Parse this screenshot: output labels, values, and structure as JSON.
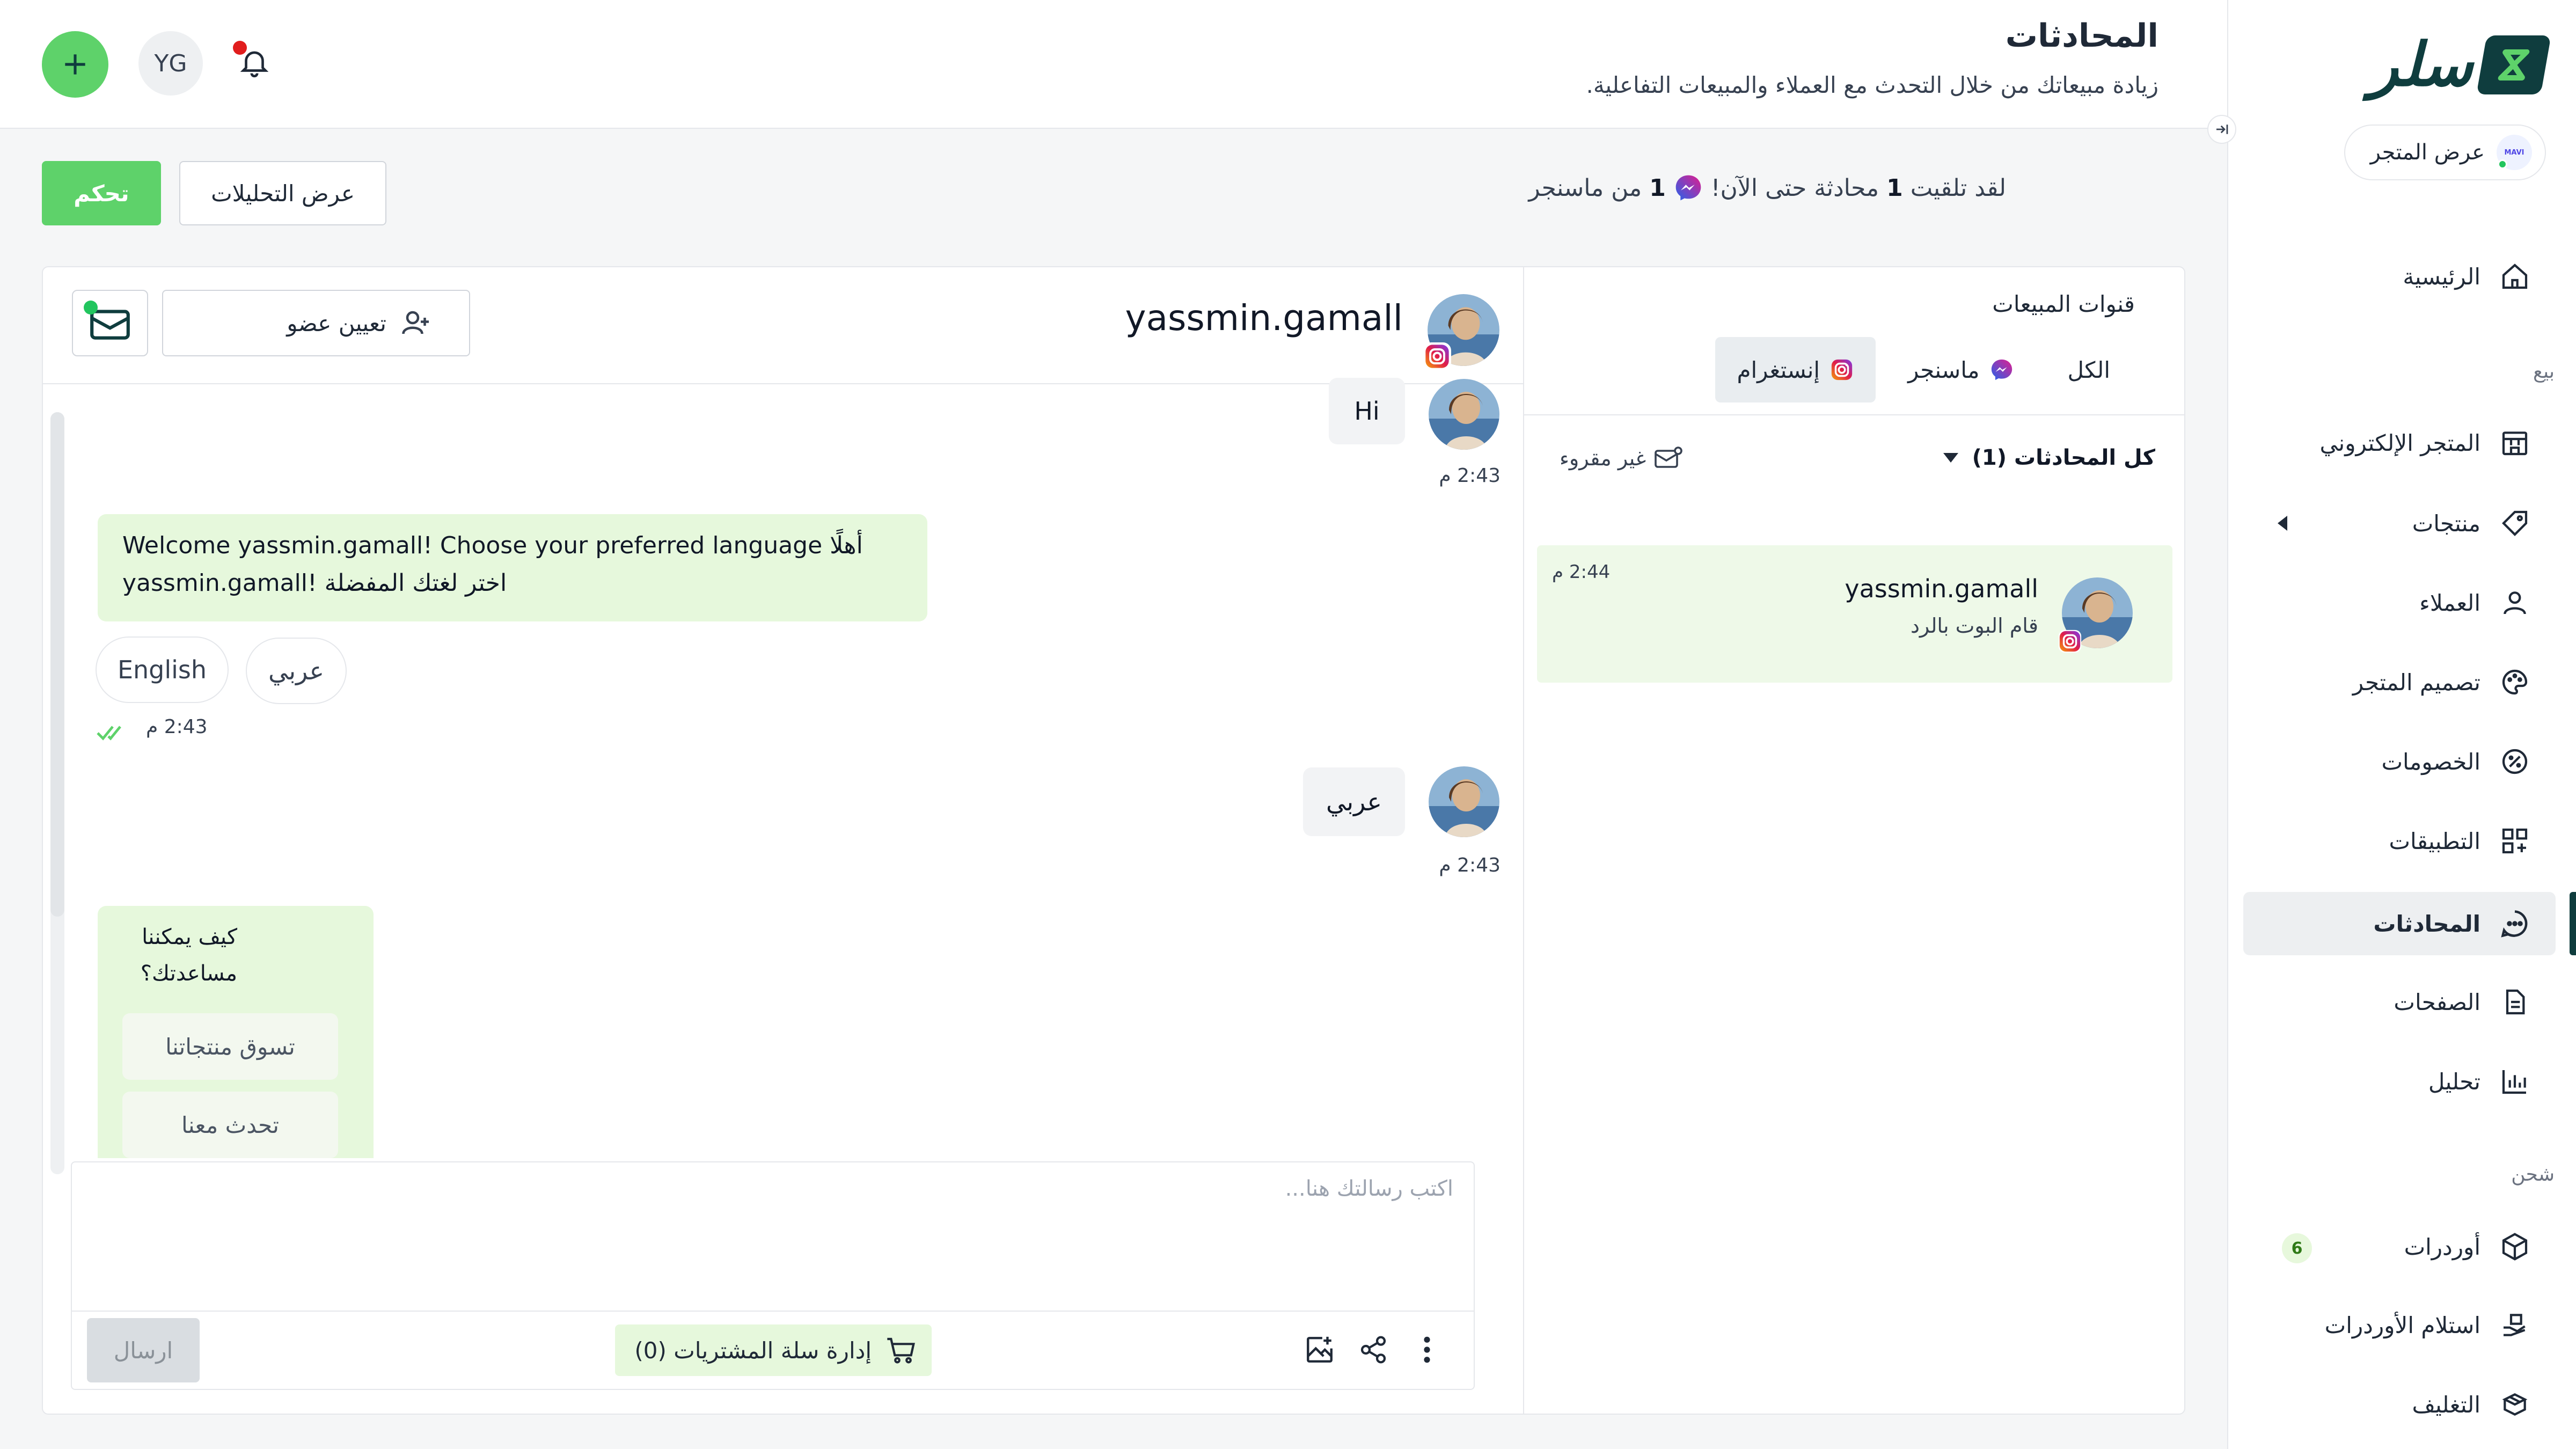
{
  "colors": {
    "accent": "#5ed26a",
    "brand": "#0f3d3e",
    "bot_bubble": "#e6f8dc",
    "notification": "#e11d1d"
  },
  "sidebar": {
    "logo_text": "سلر",
    "store_button": {
      "avatar_text": "MAVI",
      "label": "عرض المتجر"
    },
    "sections": {
      "sell": "بيع",
      "shipping": "شحن"
    },
    "items": [
      {
        "label": "الرئيسية",
        "icon": "home-icon"
      },
      {
        "label": "المتجر الإلكتروني",
        "icon": "store-icon"
      },
      {
        "label": "منتجات",
        "icon": "tag-icon"
      },
      {
        "label": "العملاء",
        "icon": "user-icon"
      },
      {
        "label": "تصميم المتجر",
        "icon": "palette-icon"
      },
      {
        "label": "الخصومات",
        "icon": "discount-icon"
      },
      {
        "label": "التطبيقات",
        "icon": "apps-icon"
      },
      {
        "label": "المحادثات",
        "icon": "chat-icon",
        "active": true
      },
      {
        "label": "الصفحات",
        "icon": "document-icon"
      },
      {
        "label": "تحليل",
        "icon": "bar-chart-icon"
      },
      {
        "label": "أوردرات",
        "icon": "box-icon",
        "badge": "6"
      },
      {
        "label": "استلام الأوردرات",
        "icon": "hand-box-icon"
      },
      {
        "label": "التغليف",
        "icon": "package-icon"
      }
    ]
  },
  "header": {
    "title": "المحادثات",
    "subtitle": "زيادة مبيعاتك من خلال التحدث مع العملاء والمبيعات التفاعلية.",
    "user_initials": "YG"
  },
  "infobar": {
    "text_before": "لقد تلقيت",
    "count_a": "1",
    "text_middle": "محادثة حتى الآن!",
    "count_b": "1",
    "text_after": "من ماسنجر",
    "analytics_button": "عرض التحليلات",
    "control_button": "تحكم"
  },
  "list": {
    "sales_channels_title": "قنوات المبيعات",
    "tabs": [
      {
        "label": "الكل"
      },
      {
        "label": "ماسنجر",
        "icon": "messenger-icon"
      },
      {
        "label": "إنستغرام",
        "icon": "instagram-icon",
        "active": true
      }
    ],
    "filter_all": "كل المحادثات (1)",
    "filter_unread": "غير مقروء",
    "conversations": [
      {
        "name": "yassmin.gamall",
        "subtitle": "قام البوت بالرد",
        "time": "2:44 م"
      }
    ]
  },
  "chat": {
    "contact_name": "yassmin.gamall",
    "assign_label": "تعيين عضو",
    "messages": {
      "hi": {
        "text": "Hi",
        "time": "2:43 م"
      },
      "welcome": {
        "line1": "Welcome yassmin.gamall! Choose your preferred language أهلًا",
        "line2": "yassmin.gamall! اختر لغتك المفضلة",
        "time": "2:43 م"
      },
      "lang_options": [
        "English",
        "عربي"
      ],
      "arabic_reply": {
        "text": "عربي",
        "time": "2:43 م"
      },
      "help": {
        "line1": "كيف يمكننا",
        "line2": "مساعدتك؟",
        "buttons": [
          "تسوق منتجاتنا",
          "تحدث معنا"
        ]
      }
    },
    "composer": {
      "placeholder": "اكتب رسالتك هنا...",
      "send": "ارسال",
      "cart": "إدارة سلة المشتريات (0)"
    }
  }
}
